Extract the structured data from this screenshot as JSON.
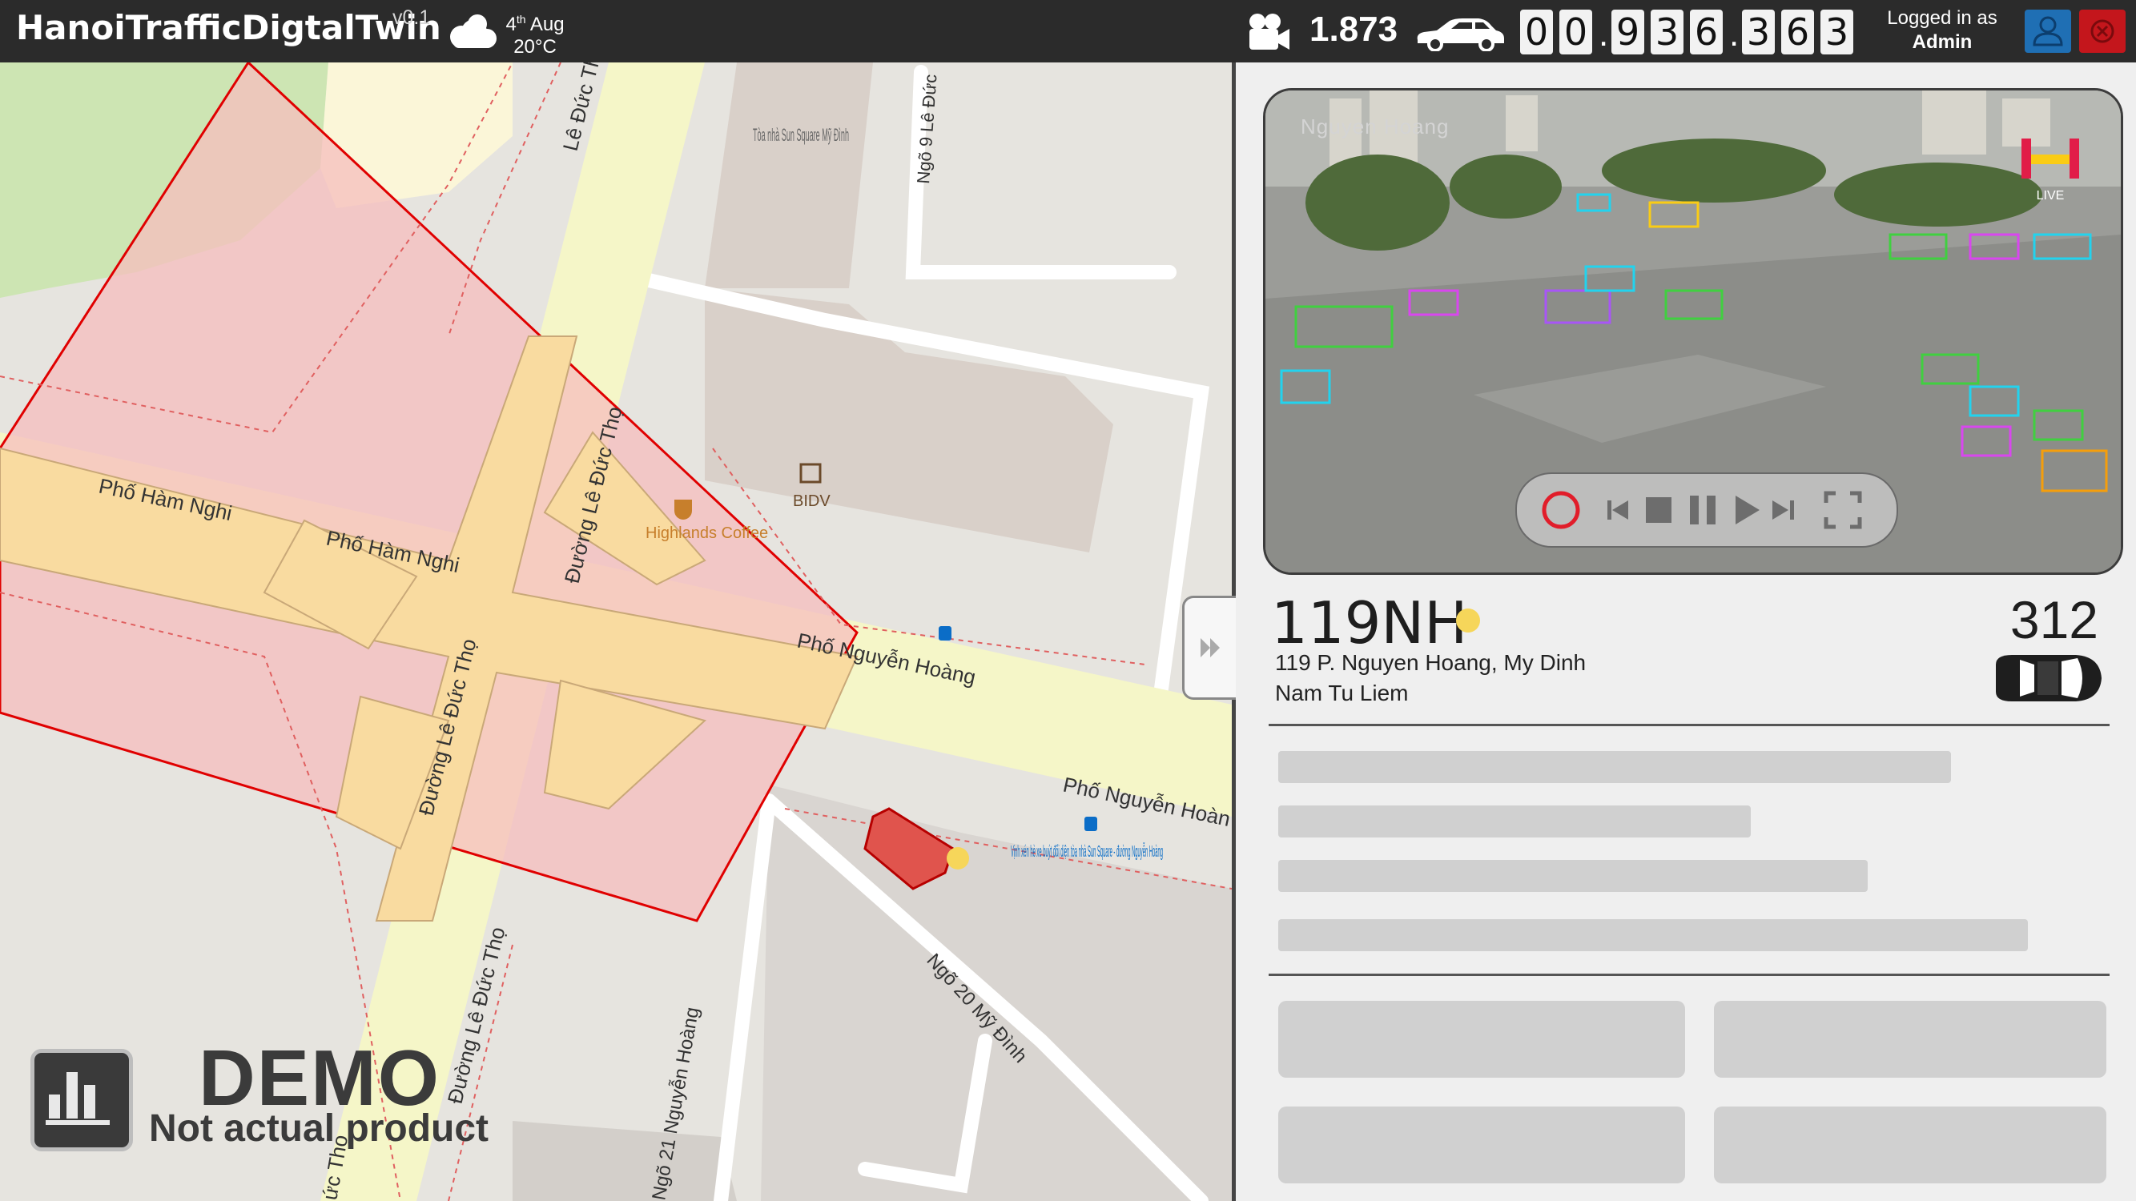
{
  "app": {
    "title": "HanoiTrafficDigtalTwin",
    "version": "v0.1"
  },
  "weather": {
    "icon": "cloud-sun-icon",
    "date_day": "4",
    "date_suffix": "th",
    "date_month": "Aug",
    "temperature": "20°C"
  },
  "stats": {
    "camera_icon": "camera-icon",
    "camera_count": "1.873",
    "vehicle_icon": "car-icon",
    "odometer_digits": [
      "0",
      "0",
      "9",
      "3",
      "6",
      "3",
      "6",
      "3"
    ]
  },
  "user": {
    "logged_in_label": "Logged in as",
    "name": "Admin",
    "user_icon": "user-icon",
    "logout_icon": "logout-icon"
  },
  "map": {
    "street_labels": [
      "Lê Đức Th",
      "Ngõ 9 Lê Đức",
      "Phố Hàm Nghi",
      "Phố Hàm Nghi",
      "Đường Lê Đức Thọ",
      "Đường Lê Đức Thọ",
      "Đường Lê Đức Thọ",
      "Phố Nguyễn Hoàng",
      "Phố Nguyễn Hoàn",
      "Ngõ 20 Mỹ Đình",
      "Ngõ 21 Nguyễn Hoàng",
      "ức Thọ"
    ],
    "poi_building": "Tòa nhà Sun Square Mỹ Đình",
    "poi_bank": "BIDV",
    "poi_cafe": "Highlands Coffee",
    "poi_bus_stop": "Vịnh xén hè xe buýt đối diện tòa nhà Sun Square - đường Nguyễn Hoàng",
    "colors": {
      "road_major": "#f9dba0",
      "road_secondary": "#f5f6c8",
      "zone_fill": "#f5bebe",
      "zone_stroke": "#e00000",
      "park": "#cde5b3",
      "building": "#d9d0c9",
      "poi_orange": "#c77f2c",
      "bus_blue": "#0b6dc7"
    }
  },
  "demo": {
    "icon": "bar-chart-icon",
    "title": "DEMO",
    "subtitle": "Not actual product"
  },
  "panel": {
    "collapse_icon": "double-chevron-right-icon",
    "video": {
      "overlay_text": "Nguyen Hoang",
      "live_badge": "LIVE"
    },
    "controls": [
      "record-icon",
      "previous-icon",
      "stop-icon",
      "pause-icon",
      "play-icon",
      "next-icon",
      "fullscreen-icon"
    ],
    "camera_id": "119NH",
    "status_color": "#f6d65a",
    "vehicle_count": "312",
    "address_line1": "119 P. Nguyen Hoang, My Dinh",
    "address_line2": "Nam Tu Liem"
  }
}
